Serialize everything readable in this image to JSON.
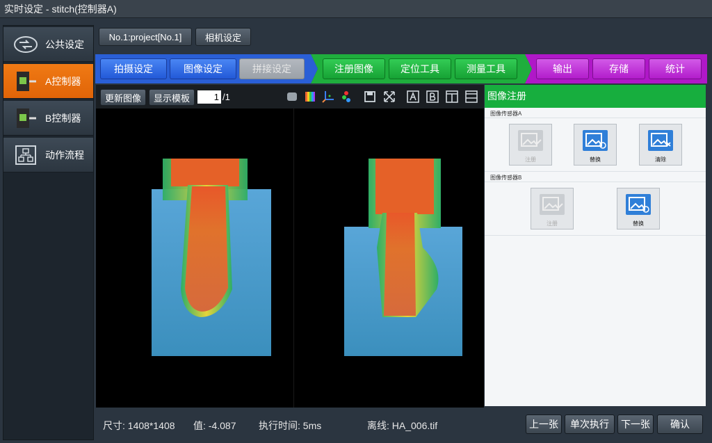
{
  "window": {
    "title": "实时设定 - stitch(控制器A)"
  },
  "sidebar": {
    "items": [
      {
        "label": "公共设定",
        "icon": "link-icon"
      },
      {
        "label": "A控制器",
        "icon": "controller-icon"
      },
      {
        "label": "B控制器",
        "icon": "controller-icon"
      },
      {
        "label": "动作流程",
        "icon": "flowchart-icon"
      }
    ],
    "active_index": 1
  },
  "top": {
    "project_label": "No.1:project[No.1]",
    "camera_label": "相机设定"
  },
  "steps": {
    "blue": [
      "拍摄设定",
      "图像设定",
      "拼接设定"
    ],
    "green": [
      "注册图像",
      "定位工具",
      "测量工具"
    ],
    "purple": [
      "输出",
      "存储",
      "统计"
    ]
  },
  "viewer": {
    "update_label": "更新图像",
    "template_label": "显示模板",
    "page_value": "1",
    "page_total": "/1",
    "tools": [
      "stop-icon",
      "color-palette-icon",
      "axes-icon",
      "channel-icon",
      "save-icon",
      "fit-icon",
      "region-a-icon",
      "region-b-icon",
      "split-vertical-icon",
      "split-horizontal-icon"
    ]
  },
  "panel": {
    "title": "图像注册",
    "groupA": {
      "label": "图像传感器A",
      "buttons": [
        "注册",
        "替换",
        "清除"
      ]
    },
    "groupB": {
      "label": "图像传感器B",
      "buttons": [
        "注册",
        "替换"
      ]
    }
  },
  "status": {
    "size": "尺寸: 1408*1408",
    "value": "值: -4.087",
    "exec_time": "执行时间: 5ms",
    "offline": "离线: HA_006.tif"
  },
  "bottom_buttons": {
    "prev": "上一张",
    "single": "单次执行",
    "next": "下一张",
    "confirm": "确认"
  },
  "colors": {
    "accent_orange": "#f07a14",
    "blue": "#2a5fd6",
    "green": "#1fae3d",
    "purple": "#b018c8"
  }
}
